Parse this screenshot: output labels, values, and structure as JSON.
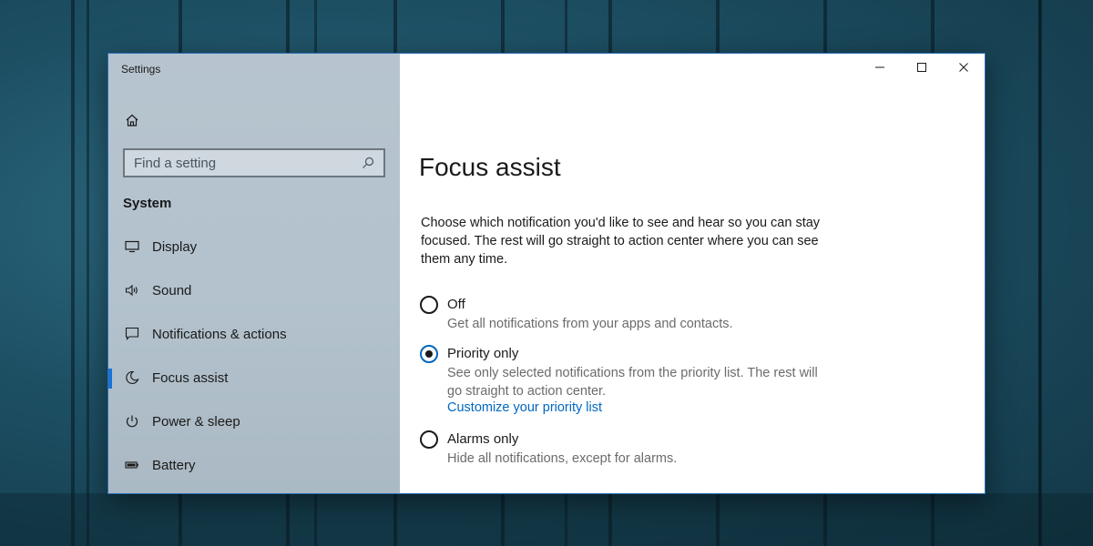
{
  "window": {
    "title": "Settings",
    "controls": {
      "minimize": "—",
      "maximize": "☐",
      "close": "✕"
    }
  },
  "sidebar": {
    "search_placeholder": "Find a setting",
    "section_title": "System",
    "items": [
      {
        "label": "Display",
        "icon": "monitor-icon",
        "active": false
      },
      {
        "label": "Sound",
        "icon": "speaker-icon",
        "active": false
      },
      {
        "label": "Notifications & actions",
        "icon": "message-icon",
        "active": false
      },
      {
        "label": "Focus assist",
        "icon": "moon-icon",
        "active": true
      },
      {
        "label": "Power & sleep",
        "icon": "power-icon",
        "active": false
      },
      {
        "label": "Battery",
        "icon": "battery-icon",
        "active": false
      }
    ]
  },
  "main": {
    "title": "Focus assist",
    "intro": "Choose which notification you'd like to see and hear so you can stay focused. The rest will go straight to action center where you can see them any time.",
    "options": [
      {
        "label": "Off",
        "description": "Get all notifications from your apps and contacts.",
        "selected": false
      },
      {
        "label": "Priority only",
        "description": "See only selected notifications from the priority list. The rest will go straight to action center.",
        "link": "Customize your priority list",
        "selected": true
      },
      {
        "label": "Alarms only",
        "description": "Hide all notifications, except for alarms.",
        "selected": false
      }
    ]
  },
  "colors": {
    "accent": "#0067c0",
    "sidebar_bg": "#b5c3ce",
    "active_indicator": "#1a73d4"
  }
}
